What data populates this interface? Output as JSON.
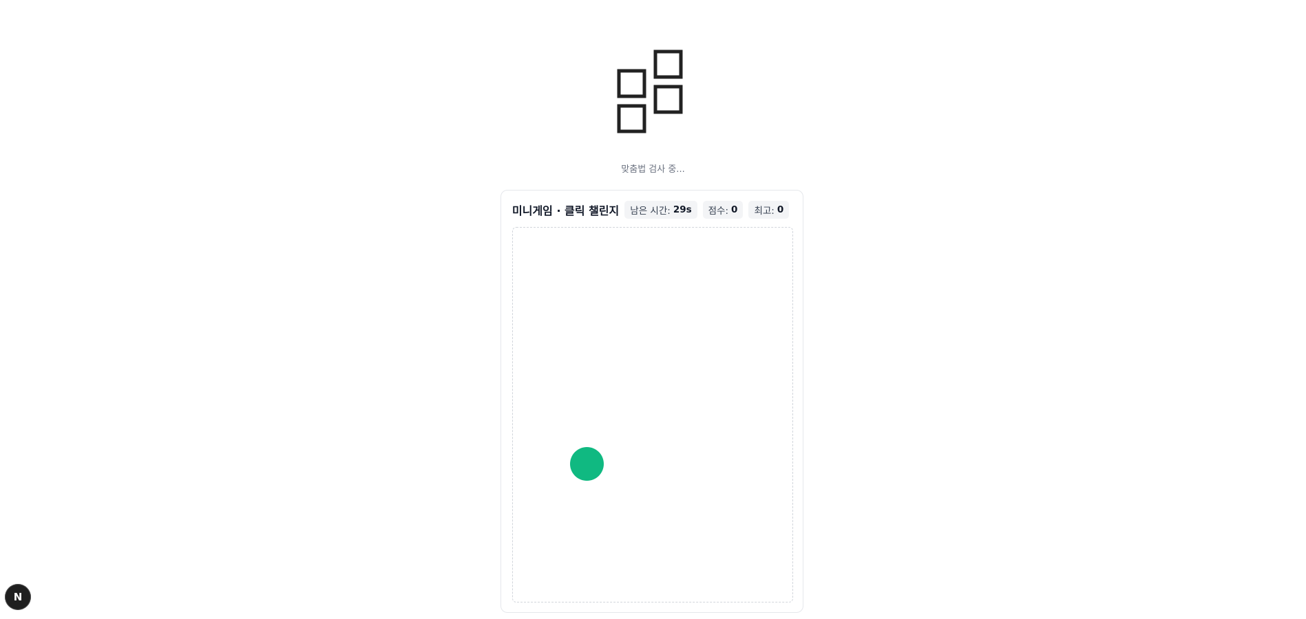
{
  "loader": {
    "icon": "stacked-squares-loader-icon"
  },
  "status": {
    "text": "맞춤법 검사 중..."
  },
  "game": {
    "title": "미니게임 · 클릭 챌린지",
    "time_label": "남은 시간:",
    "time_value": "29s",
    "score_label": "점수:",
    "score_value": "0",
    "best_label": "최고:",
    "best_value": "0",
    "target_color": "#10b981"
  },
  "dev_badge": {
    "letter": "N",
    "icon": "nextjs-logo-icon"
  }
}
